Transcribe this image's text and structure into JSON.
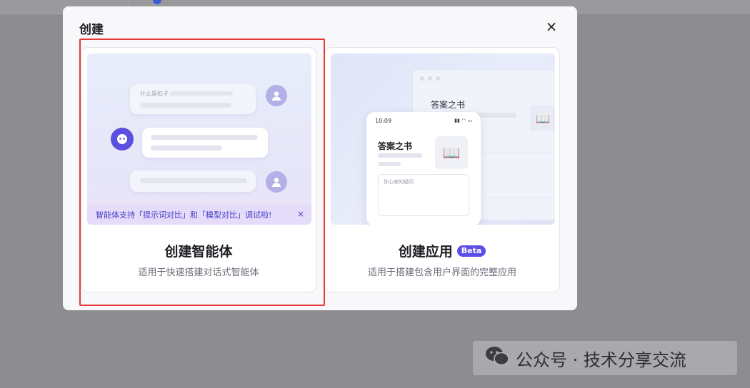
{
  "modal": {
    "title": "创建",
    "close_icon": "×"
  },
  "cards": {
    "agent": {
      "title": "创建智能体",
      "description": "适用于快速搭建对话式智能体",
      "preview": {
        "question_text": "什么是扣子",
        "banner_text": "智能体支持「提示词对比」和「模型对比」调试啦!",
        "banner_close": "×"
      },
      "selected": true
    },
    "app": {
      "title": "创建应用",
      "badge": "Beta",
      "description": "适用于搭建包含用户界面的完整应用",
      "preview": {
        "browser_title": "答案之书",
        "phone_time": "10:09",
        "phone_title": "答案之书",
        "input_placeholder": "你心底的疑问"
      }
    }
  },
  "watermark": {
    "icon": "wechat-icon",
    "text": "公众号 · 技术分享交流"
  },
  "colors": {
    "accent": "#5a4fe6",
    "selected_outline": "#e53935",
    "overlay": "#8d8d90"
  }
}
